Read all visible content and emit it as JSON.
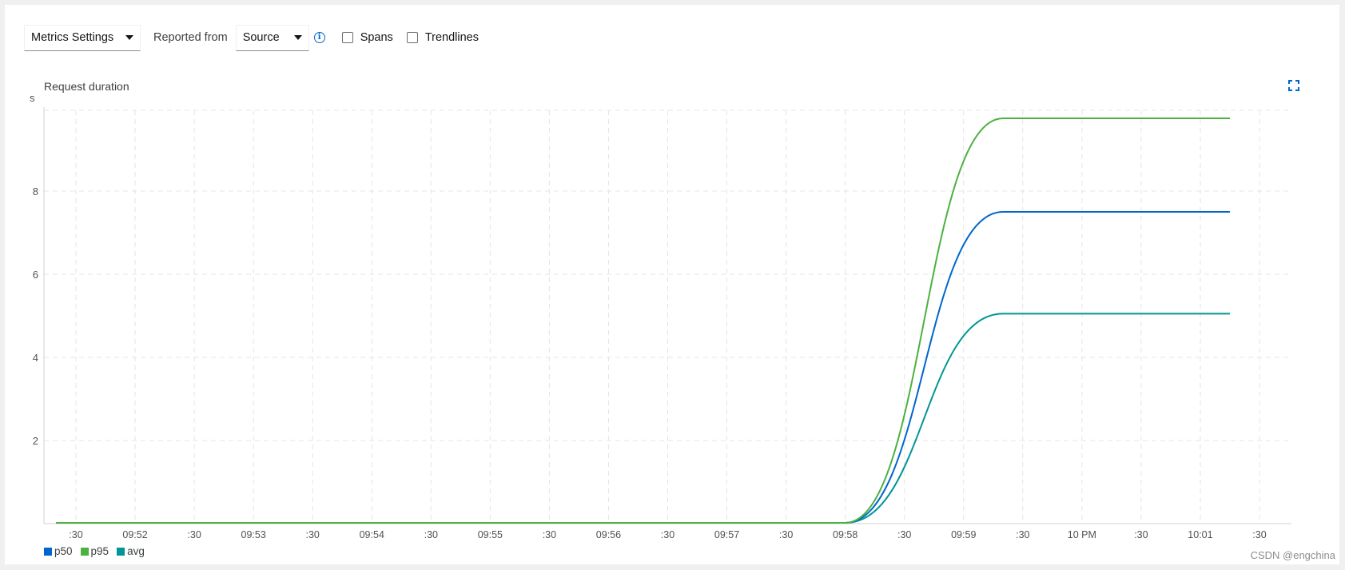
{
  "toolbar": {
    "metrics_settings_label": "Metrics Settings",
    "reported_from_label": "Reported from",
    "source_value": "Source",
    "spans_label": "Spans",
    "trendlines_label": "Trendlines",
    "info_icon": "info-circle-icon"
  },
  "chart": {
    "expand_icon": "expand-icon"
  },
  "watermark": "CSDN @engchina",
  "colors": {
    "p50": "#0066cc",
    "p95": "#4cb140",
    "avg": "#009596",
    "grid": "#e4e4e4",
    "axis": "#d2d2d2"
  },
  "chart_data": {
    "type": "line",
    "title": "Request duration",
    "ylabel": "s",
    "xlabel": "",
    "ylim": [
      0,
      10
    ],
    "yticks": [
      "2",
      "4",
      "6",
      "8"
    ],
    "xticks": [
      ":30",
      "09:52",
      ":30",
      "09:53",
      ":30",
      "09:54",
      ":30",
      "09:55",
      ":30",
      "09:56",
      ":30",
      "09:57",
      ":30",
      "09:58",
      ":30",
      "09:59",
      ":30",
      "10 PM",
      ":30",
      "10:01",
      ":30"
    ],
    "grid": true,
    "legend_position": "bottom-left",
    "series": [
      {
        "name": "p50",
        "flat_value": 0.02,
        "final_value": 7.5
      },
      {
        "name": "p95",
        "flat_value": 0.02,
        "final_value": 9.75
      },
      {
        "name": "avg",
        "flat_value": 0.02,
        "final_value": 5.05
      }
    ],
    "rise_start": "09:58:00",
    "rise_end": "09:59:20",
    "x_start": "09:51:20",
    "x_end": "10:01:15"
  }
}
